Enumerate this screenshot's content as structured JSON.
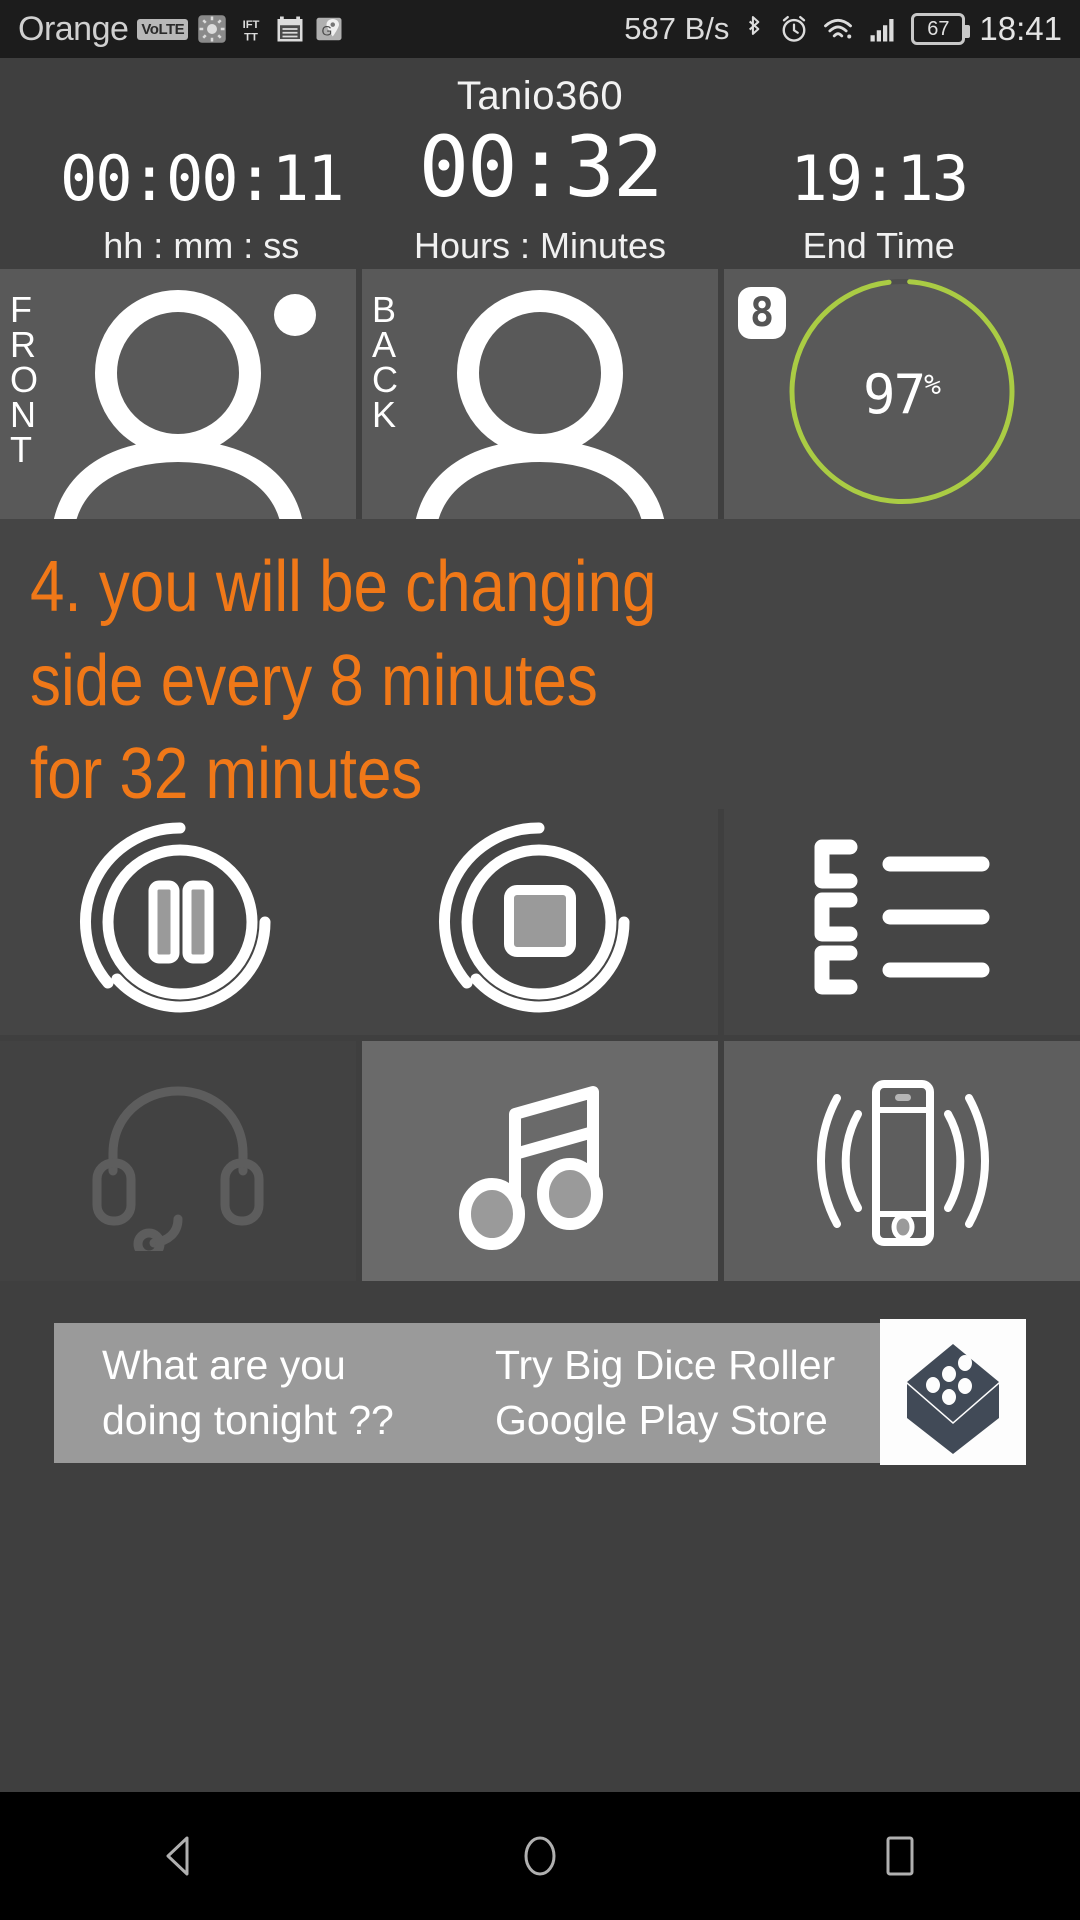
{
  "statusbar": {
    "carrier": "Orange",
    "volte_badge": "VoLTE",
    "icons": [
      "brightness-icon",
      "ifttt-icon",
      "calendar-icon",
      "maps-icon"
    ],
    "net_speed": "587 B/s",
    "bluetooth_icon": "bluetooth-icon",
    "alarm_icon": "alarm-icon",
    "wifi_icon": "wifi-icon",
    "signal_icon": "cellular-signal-icon",
    "battery_level": "67",
    "clock": "18:41"
  },
  "header": {
    "app_title": "Tanio360",
    "timers": [
      {
        "value": "00:00:11",
        "label": "hh : mm : ss",
        "size": "small"
      },
      {
        "value": "00:32",
        "label": "Hours : Minutes",
        "size": "big"
      },
      {
        "value": "19:13",
        "label": "End Time",
        "size": "small"
      }
    ]
  },
  "panels": {
    "front": {
      "label_letters": [
        "F",
        "R",
        "O",
        "N",
        "T"
      ],
      "icon": "person-front-icon",
      "indicator": "white-dot-indicator"
    },
    "back": {
      "label_letters": [
        "B",
        "A",
        "C",
        "K"
      ],
      "icon": "person-back-icon"
    },
    "progress": {
      "badge": "8",
      "percent": "97",
      "percent_symbol": "%",
      "ring_color": "#aacc44",
      "ring_value": 97
    }
  },
  "instructions": {
    "lines": [
      "4. you will be changing",
      "side every 8 minutes",
      "for 32 minutes"
    ],
    "color": "#f07818"
  },
  "controls": {
    "row1": [
      {
        "name": "pause-button",
        "icon": "pause-icon"
      },
      {
        "name": "stop-button",
        "icon": "stop-icon"
      },
      {
        "name": "list-button",
        "icon": "list-icon"
      }
    ],
    "row2": [
      {
        "name": "headset-button",
        "icon": "headset-icon",
        "state": "disabled"
      },
      {
        "name": "music-button",
        "icon": "music-note-icon",
        "state": "active"
      },
      {
        "name": "vibrate-button",
        "icon": "phone-vibrate-icon",
        "state": "enabled"
      }
    ]
  },
  "ad": {
    "line1": "What are you",
    "line2": "doing tonight ??",
    "line3": "Try Big Dice Roller",
    "line4": "Google Play Store",
    "logo": "dice-logo-icon"
  },
  "navbar": {
    "back": "back-nav-icon",
    "home": "home-nav-icon",
    "recents": "recents-nav-icon"
  },
  "colors": {
    "app_background": "#3f3f3f",
    "panel": "#595959",
    "accent_orange": "#f07818",
    "accent_green": "#aacc44"
  }
}
